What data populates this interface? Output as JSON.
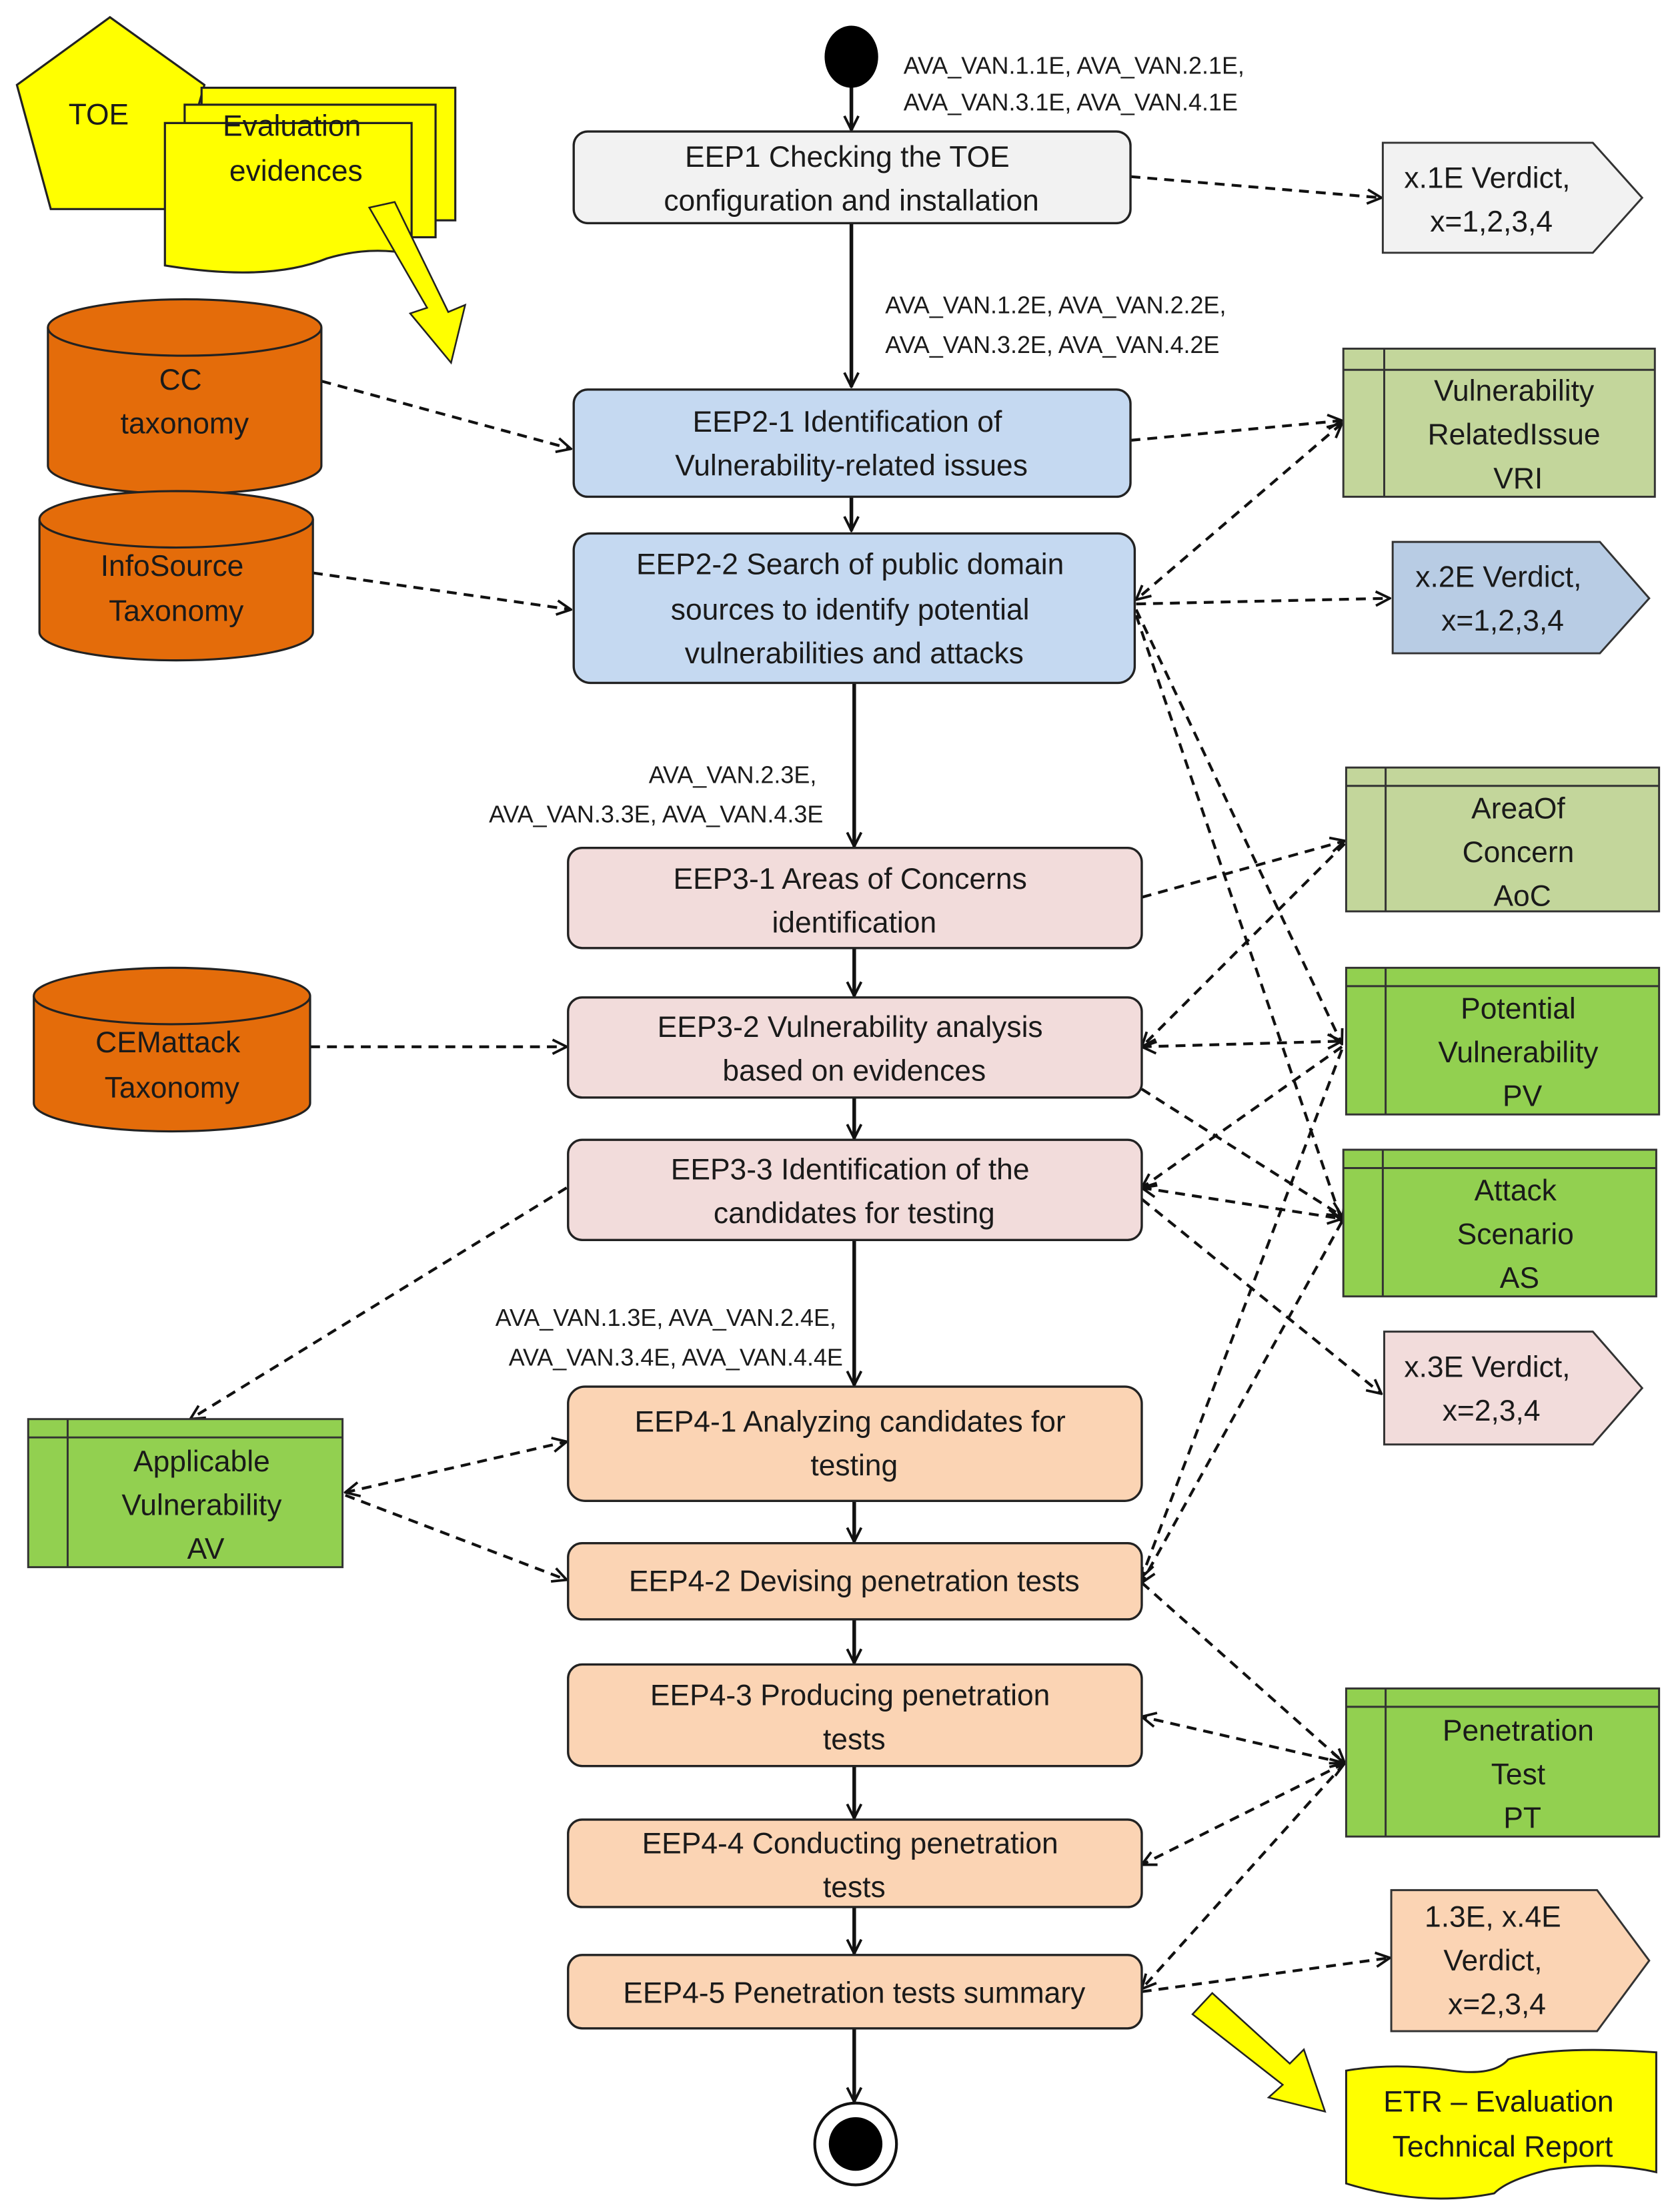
{
  "diagram": {
    "inputs": {
      "toe": "TOE",
      "evidences": [
        "Evaluation",
        "evidences"
      ]
    },
    "conditions": {
      "c1": [
        "AVA_VAN.1.1E, AVA_VAN.2.1E,",
        "AVA_VAN.3.1E, AVA_VAN.4.1E"
      ],
      "c2": [
        "AVA_VAN.1.2E, AVA_VAN.2.2E,",
        "AVA_VAN.3.2E, AVA_VAN.4.2E"
      ],
      "c3": [
        "AVA_VAN.2.3E,",
        "AVA_VAN.3.3E, AVA_VAN.4.3E"
      ],
      "c4": [
        "AVA_VAN.1.3E, AVA_VAN.2.4E,",
        "AVA_VAN.3.4E, AVA_VAN.4.4E"
      ]
    },
    "activities": {
      "eep1": [
        "EEP1 Checking the TOE",
        "configuration and installation"
      ],
      "eep2_1": [
        "EEP2-1 Identification of",
        "Vulnerability-related issues"
      ],
      "eep2_2": [
        "EEP2-2 Search of public domain",
        "sources to identify potential",
        "vulnerabilities and attacks"
      ],
      "eep3_1": [
        "EEP3-1 Areas of Concerns",
        "identification"
      ],
      "eep3_2": [
        "EEP3-2 Vulnerability analysis",
        "based on evidences"
      ],
      "eep3_3": [
        "EEP3-3 Identification of the",
        "candidates for testing"
      ],
      "eep4_1": [
        "EEP4-1 Analyzing candidates for",
        "testing"
      ],
      "eep4_2": [
        "EEP4-2 Devising penetration tests"
      ],
      "eep4_3": [
        "EEP4-3 Producing penetration",
        "tests"
      ],
      "eep4_4": [
        "EEP4-4 Conducting penetration",
        "tests"
      ],
      "eep4_5": [
        "EEP4-5 Penetration tests summary"
      ]
    },
    "taxonomies": {
      "cc": [
        "CC",
        "taxonomy"
      ],
      "infosource": [
        "InfoSource",
        "Taxonomy"
      ],
      "cemattack": [
        "CEMattack",
        "Taxonomy"
      ]
    },
    "artifacts": {
      "vri": [
        "Vulnerability",
        "RelatedIssue",
        "VRI"
      ],
      "aoc": [
        "AreaOf",
        "Concern",
        "AoC"
      ],
      "pv": [
        "Potential",
        "Vulnerability",
        "PV"
      ],
      "as": [
        "Attack",
        "Scenario",
        "AS"
      ],
      "av": [
        "Applicable",
        "Vulnerability",
        "AV"
      ],
      "pt": [
        "Penetration",
        "Test",
        "PT"
      ]
    },
    "verdicts": {
      "v1": [
        "x.1E Verdict,",
        "x=1,2,3,4"
      ],
      "v2": [
        "x.2E Verdict,",
        "x=1,2,3,4"
      ],
      "v3": [
        "x.3E Verdict,",
        "x=2,3,4"
      ],
      "v4": [
        "1.3E, x.4E",
        "Verdict,",
        "x=2,3,4"
      ]
    },
    "output": {
      "etr": [
        "ETR – Evaluation",
        "Technical Report"
      ]
    },
    "colors": {
      "eep1": "#f2f2f2",
      "eep2": "#c5d9f1",
      "eep3": "#f2dcdb",
      "eep4": "#fbd4b4",
      "taxonomy": "#e46c0a",
      "artifact_light": "#c3d69b",
      "artifact_dark": "#92d050",
      "io_yellow": "#ffff00"
    }
  }
}
